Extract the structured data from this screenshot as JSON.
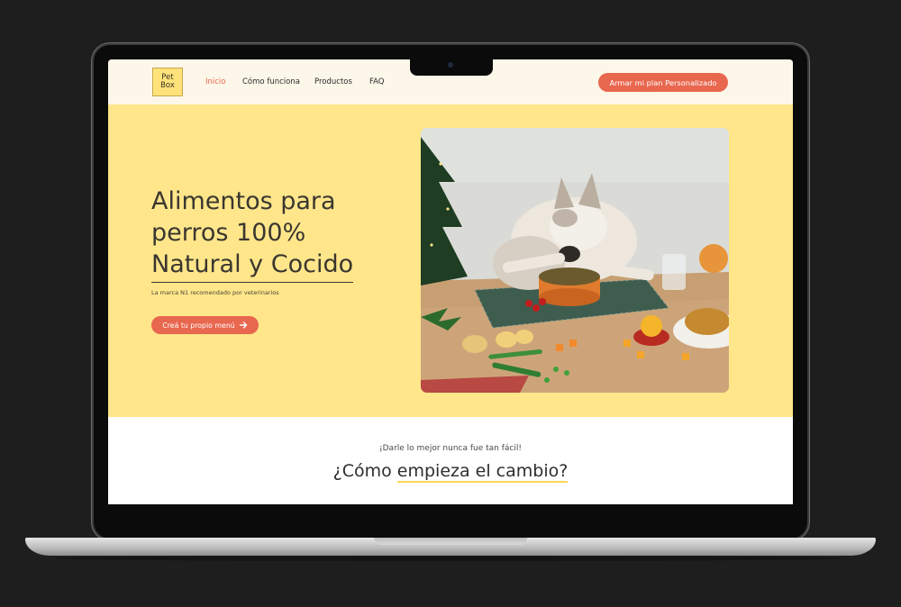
{
  "nav": {
    "logo_line1": "Pet",
    "logo_line2": "Box",
    "links": [
      "Inicio",
      "Cómo funciona",
      "Productos",
      "FAQ"
    ],
    "cta": "Armar mi plan Personalizado"
  },
  "hero": {
    "title_line1": "Alimentos para",
    "title_line2": "perros 100%",
    "title_line3": "Natural y Cocido",
    "subtitle": "La marca N1 recomendado por veterinarios",
    "button": "Creá tu propio menú"
  },
  "section": {
    "kicker": "¡Darle lo mejor nunca fue tan fácil!",
    "title_pre": "¿Cómo ",
    "title_highlight": "empieza el cambio?"
  },
  "colors": {
    "accent": "#e8674f",
    "hero_bg": "#ffe68a",
    "logo_bg": "#ffe27a"
  }
}
